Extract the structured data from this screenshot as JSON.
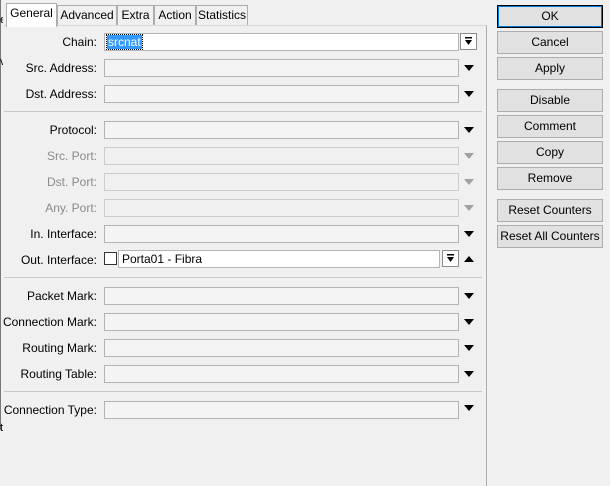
{
  "tabs": [
    {
      "label": "General"
    },
    {
      "label": "Advanced"
    },
    {
      "label": "Extra"
    },
    {
      "label": "Action"
    },
    {
      "label": "Statistics"
    }
  ],
  "fields": {
    "chain": {
      "label": "Chain:",
      "value": "srcnat"
    },
    "src_address": {
      "label": "Src. Address:"
    },
    "dst_address": {
      "label": "Dst. Address:"
    },
    "protocol": {
      "label": "Protocol:"
    },
    "src_port": {
      "label": "Src. Port:"
    },
    "dst_port": {
      "label": "Dst. Port:"
    },
    "any_port": {
      "label": "Any. Port:"
    },
    "in_interface": {
      "label": "In. Interface:"
    },
    "out_interface": {
      "label": "Out. Interface:",
      "value": "Porta01 - Fibra"
    },
    "packet_mark": {
      "label": "Packet Mark:"
    },
    "connection_mark": {
      "label": "Connection Mark:"
    },
    "routing_mark": {
      "label": "Routing Mark:"
    },
    "routing_table": {
      "label": "Routing Table:"
    },
    "connection_type": {
      "label": "Connection Type:"
    }
  },
  "buttons": {
    "ok": "OK",
    "cancel": "Cancel",
    "apply": "Apply",
    "disable": "Disable",
    "comment": "Comment",
    "copy": "Copy",
    "remove": "Remove",
    "reset_counters": "Reset Counters",
    "reset_all_counters": "Reset All Counters"
  },
  "left_edge_chars": [
    "e",
    "v",
    "t"
  ],
  "icons": {
    "dropdown": "triangle-down-icon",
    "dropdown_disabled": "triangle-down-disabled-icon",
    "combo": "combo-arrow-icon",
    "collapse": "triangle-up-icon"
  }
}
